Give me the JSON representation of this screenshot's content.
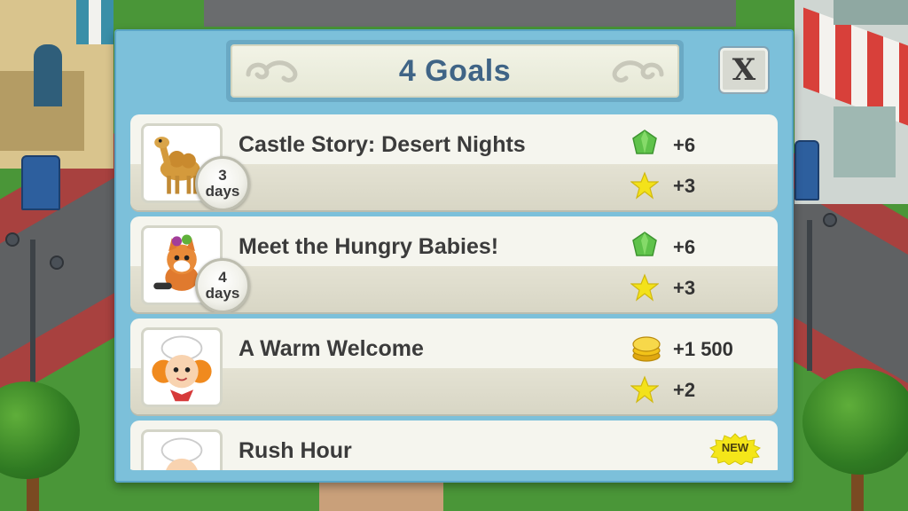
{
  "dialog": {
    "title": "4 Goals",
    "close_label": "X"
  },
  "goals": [
    {
      "title": "Castle Story: Desert Nights",
      "portrait": "camel",
      "days_number": "3",
      "days_label": "days",
      "reward_top": {
        "icon": "green-gem",
        "value": "+6"
      },
      "reward_bottom": {
        "icon": "star",
        "value": "+3"
      }
    },
    {
      "title": "Meet the Hungry Babies!",
      "portrait": "fox-cub",
      "days_number": "4",
      "days_label": "days",
      "reward_top": {
        "icon": "green-gem",
        "value": "+6"
      },
      "reward_bottom": {
        "icon": "star",
        "value": "+3"
      }
    },
    {
      "title": "A Warm Welcome",
      "portrait": "chef-girl",
      "reward_top": {
        "icon": "gold-coins",
        "value": "+1 500"
      },
      "reward_bottom": {
        "icon": "star",
        "value": "+2"
      }
    },
    {
      "title": "Rush Hour",
      "portrait": "chef",
      "badge": "NEW"
    }
  ],
  "colors": {
    "dialog_frame": "#7cc0da",
    "title_text": "#3f6486",
    "card_bg": "#f5f5ee",
    "gem": "#5fc24a",
    "star": "#f3e21a",
    "coin": "#f2c318"
  }
}
